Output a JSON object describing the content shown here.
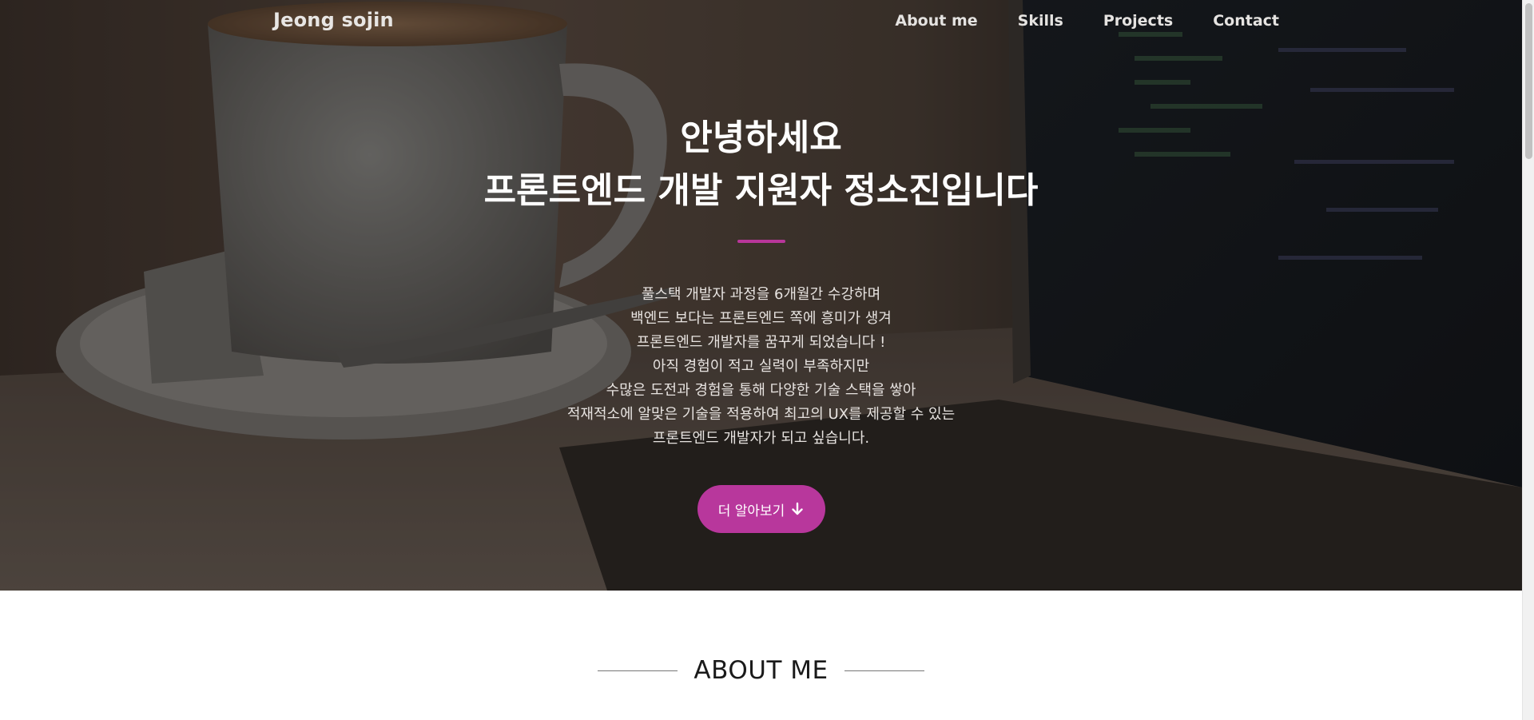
{
  "nav": {
    "brand": "Jeong sojin",
    "links": [
      "About me",
      "Skills",
      "Projects",
      "Contact"
    ]
  },
  "hero": {
    "title_lines": [
      "안녕하세요",
      "프론트엔드 개발 지원자 정소진입니다"
    ],
    "description_lines": [
      "풀스택 개발자 과정을 6개월간 수강하며",
      "백엔드 보다는 프론트엔드 쪽에 흥미가 생겨",
      "프론트엔드 개발자를 꿈꾸게 되었습니다 !",
      "아직 경험이 적고 실력이 부족하지만",
      "수많은 도전과 경험을 통해 다양한 기술 스택을 쌓아",
      "적재적소에 알맞은 기술을 적용하여 최고의 UX를 제공할 수 있는",
      "프론트엔드 개발자가 되고 싶습니다."
    ],
    "cta_label": "더 알아보기",
    "cta_icon": "arrow-down-icon",
    "accent_color": "#b8379c",
    "background": "coffee cup and laptop photo"
  },
  "about": {
    "heading": "ABOUT ME"
  }
}
